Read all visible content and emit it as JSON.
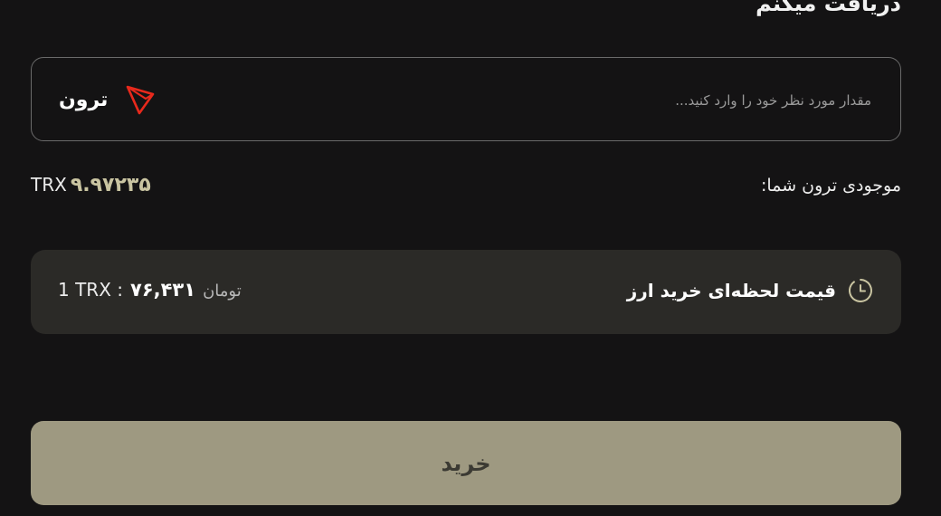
{
  "header": {
    "title": "دریافت میکنم"
  },
  "amount": {
    "placeholder": "مقدار مورد نظر خود را وارد کنید...",
    "currency_label": "ترون",
    "currency_icon": "tron-icon",
    "icon_color": "#e8291c"
  },
  "balance": {
    "label": "موجودی ترون شما:",
    "amount": "۹.۹۷۲۳۵",
    "unit": "TRX"
  },
  "price": {
    "title": "قیمت لحظه‌ای خرید ارز",
    "icon": "clock-icon",
    "rate_base": "1 TRX :",
    "rate_value": "۷۶,۴۳۱",
    "rate_unit": "تومان"
  },
  "buy_button": {
    "label": "خرید",
    "color": "#9e9981"
  }
}
